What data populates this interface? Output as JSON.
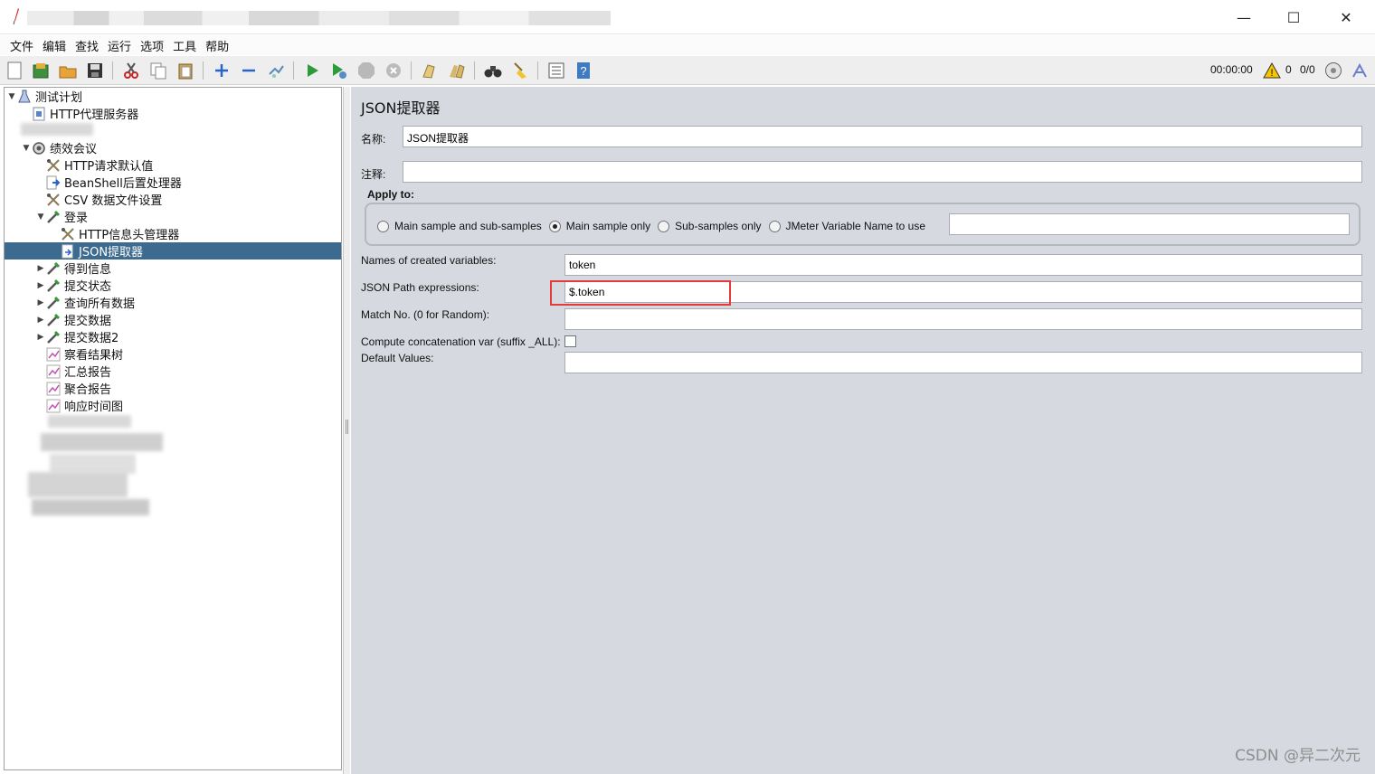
{
  "window": {
    "title": "",
    "minimize_glyph": "—",
    "maximize_glyph": "☐",
    "close_glyph": "✕"
  },
  "menu": [
    "文件",
    "编辑",
    "查找",
    "运行",
    "选项",
    "工具",
    "帮助"
  ],
  "toolbar": {
    "elapsed_time": "00:00:00",
    "warning_count": "0",
    "threads": "0/0"
  },
  "tree": [
    {
      "label": "测试计划",
      "icon": "test-plan-icon",
      "toggle": "▼"
    },
    {
      "label": "HTTP代理服务器",
      "icon": "proxy-server-icon",
      "toggle": ""
    },
    {
      "label": "绩效会议",
      "icon": "thread-group-icon",
      "toggle": "▼"
    },
    {
      "label": "HTTP请求默认值",
      "icon": "config-element-icon",
      "toggle": ""
    },
    {
      "label": "BeanShell后置处理器",
      "icon": "post-processor-icon",
      "toggle": ""
    },
    {
      "label": "CSV 数据文件设置",
      "icon": "config-element-icon",
      "toggle": ""
    },
    {
      "label": "登录",
      "icon": "sampler-icon",
      "toggle": "▼"
    },
    {
      "label": "HTTP信息头管理器",
      "icon": "config-element-icon",
      "toggle": ""
    },
    {
      "label": "JSON提取器",
      "icon": "extractor-icon",
      "toggle": ""
    },
    {
      "label": "得到信息",
      "icon": "sampler-icon",
      "toggle": "▶"
    },
    {
      "label": "提交状态",
      "icon": "sampler-icon",
      "toggle": "▶"
    },
    {
      "label": "查询所有数据",
      "icon": "sampler-icon",
      "toggle": "▶"
    },
    {
      "label": "提交数据",
      "icon": "sampler-icon",
      "toggle": "▶"
    },
    {
      "label": "提交数据2",
      "icon": "sampler-icon",
      "toggle": "▶"
    },
    {
      "label": "察看结果树",
      "icon": "listener-icon",
      "toggle": ""
    },
    {
      "label": "汇总报告",
      "icon": "listener-icon",
      "toggle": ""
    },
    {
      "label": "聚合报告",
      "icon": "listener-icon",
      "toggle": ""
    },
    {
      "label": "响应时间图",
      "icon": "listener-icon",
      "toggle": ""
    }
  ],
  "form": {
    "title": "JSON提取器",
    "name_label": "名称:",
    "name_value": "JSON提取器",
    "comment_label": "注释:",
    "comment_value": "",
    "apply_to_label": "Apply to:",
    "apply_options": [
      "Main sample and sub-samples",
      "Main sample only",
      "Sub-samples only",
      "JMeter Variable Name to use"
    ],
    "apply_selected": "Main sample only",
    "jmeter_variable_value": "",
    "names_label": "Names of created variables:",
    "names_value": "token",
    "path_label": "JSON Path expressions:",
    "path_value": "$.token",
    "match_label": "Match No. (0 for Random):",
    "match_value": "",
    "concat_label": "Compute concatenation var (suffix _ALL):",
    "concat_checked": false,
    "default_label": "Default Values:",
    "default_value": ""
  },
  "watermark": "CSDN @异二次元",
  "colors": {
    "selection": "#3d6a8f",
    "panel_background": "#d6d9df",
    "highlight_border": "#e53a3a"
  }
}
